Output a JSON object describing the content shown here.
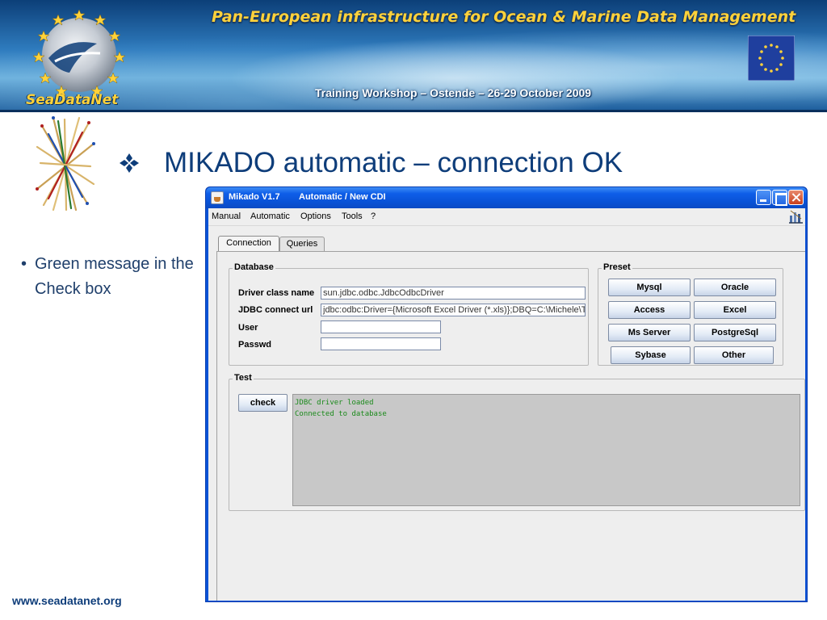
{
  "banner": {
    "title": "Pan-European infrastructure for Ocean & Marine Data Management",
    "subtitle": "Training Workshop – Ostende – 26-29 October 2009",
    "logo_text": "SeaDataNet"
  },
  "slide": {
    "title": "MIKADO automatic – connection OK",
    "bullet": "Green message in the Check box",
    "footer_url": "www.seadatanet.org"
  },
  "window": {
    "title": "Mikado V1.7",
    "subtitle": "Automatic / New CDI",
    "menu": [
      "Manual",
      "Automatic",
      "Options",
      "Tools",
      "?"
    ],
    "tabs": [
      "Connection",
      "Queries"
    ],
    "database": {
      "legend": "Database",
      "fields": [
        {
          "label": "Driver class name",
          "value": "sun.jdbc.odbc.JdbcOdbcDriver"
        },
        {
          "label": "JDBC connect url",
          "value": "jdbc:odbc:Driver={Microsoft Excel Driver (*.xls)};DBQ=C:\\Michele\\Test"
        },
        {
          "label": "User",
          "value": ""
        },
        {
          "label": "Passwd",
          "value": ""
        }
      ]
    },
    "preset": {
      "legend": "Preset",
      "buttons": [
        "Mysql",
        "Oracle",
        "Access",
        "Excel",
        "Ms Server",
        "PostgreSql",
        "Sybase",
        "Other"
      ]
    },
    "test": {
      "legend": "Test",
      "check_label": "check",
      "messages": [
        "JDBC driver loaded",
        "Connected to database"
      ],
      "message_color": "#1b8a1b"
    }
  },
  "colors": {
    "title_blue": "#0e3d7a",
    "banner_title_yellow": "#ffd23a",
    "xp_title_blue": "#0a53d6"
  }
}
